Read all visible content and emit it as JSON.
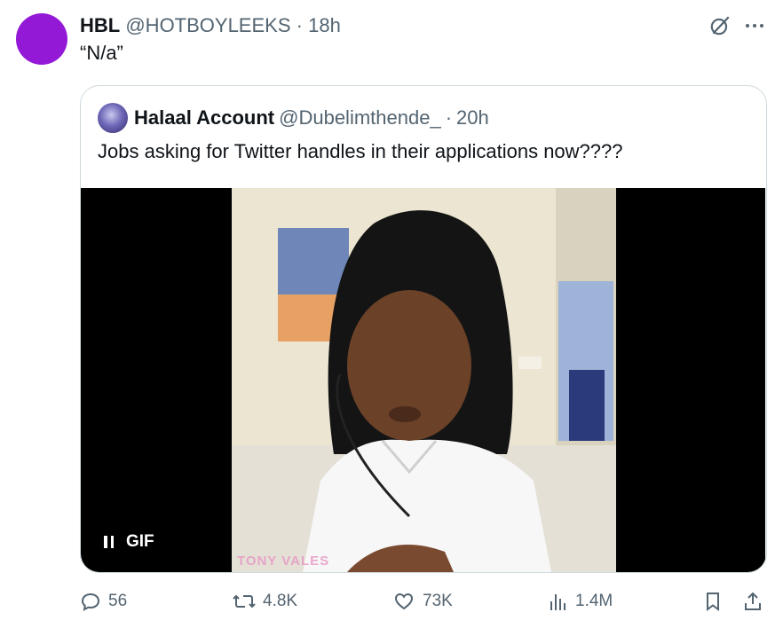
{
  "tweet": {
    "display_name": "HBL",
    "handle": "@HOTBOYLEEKS",
    "separator": "·",
    "time": "18h",
    "text": "“N/a”",
    "avatar_color": "#9419d6"
  },
  "quoted": {
    "display_name": "Halaal Account",
    "handle": "@Dubelimthende_",
    "separator": "·",
    "time": "20h",
    "text": "Jobs asking for Twitter handles in their applications now????",
    "media": {
      "type": "gif",
      "badge_label": "GIF",
      "watermark": "TONY VALES"
    }
  },
  "actions": {
    "replies": "56",
    "reposts": "4.8K",
    "likes": "73K",
    "views": "1.4M"
  },
  "icons": [
    "grok-icon",
    "more-icon",
    "reply-icon",
    "repost-icon",
    "like-icon",
    "views-icon",
    "bookmark-icon",
    "share-icon",
    "pause-icon"
  ],
  "colors": {
    "text_primary": "#0f1419",
    "text_secondary": "#536471",
    "border": "#cfd9de"
  }
}
